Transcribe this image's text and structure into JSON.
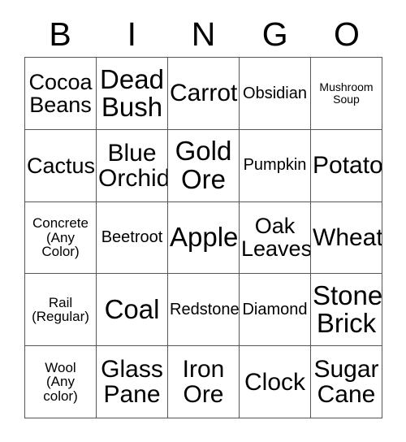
{
  "card": {
    "header_letters": [
      "B",
      "I",
      "N",
      "G",
      "O"
    ],
    "columns": 5,
    "rows": 5,
    "border_color": "#555555",
    "text_color": "#000000",
    "background_color": "#ffffff",
    "cells": [
      {
        "text": "Cocoa\nBeans",
        "size": "lg"
      },
      {
        "text": "Dead\nBush",
        "size": "xxl"
      },
      {
        "text": "Carrot",
        "size": "xl"
      },
      {
        "text": "Obsidian",
        "size": "sm"
      },
      {
        "text": "Mushroom\nSoup",
        "size": "xxs"
      },
      {
        "text": "Cactus",
        "size": "lg"
      },
      {
        "text": "Blue\nOrchid",
        "size": "xl"
      },
      {
        "text": "Gold\nOre",
        "size": "xxl"
      },
      {
        "text": "Pumpkin",
        "size": "sm"
      },
      {
        "text": "Potato",
        "size": "xl"
      },
      {
        "text": "Concrete\n(Any\nColor)",
        "size": "xs"
      },
      {
        "text": "Beetroot",
        "size": "sm"
      },
      {
        "text": "Apple",
        "size": "xxl"
      },
      {
        "text": "Oak\nLeaves",
        "size": "lg"
      },
      {
        "text": "Wheat",
        "size": "xl"
      },
      {
        "text": "Rail\n(Regular)",
        "size": "xs"
      },
      {
        "text": "Coal",
        "size": "xxl"
      },
      {
        "text": "Redstone",
        "size": "sm"
      },
      {
        "text": "Diamond",
        "size": "sm"
      },
      {
        "text": "Stone\nBrick",
        "size": "xxl"
      },
      {
        "text": "Wool\n(Any\ncolor)",
        "size": "xs"
      },
      {
        "text": "Glass\nPane",
        "size": "xl"
      },
      {
        "text": "Iron\nOre",
        "size": "xl"
      },
      {
        "text": "Clock",
        "size": "xl"
      },
      {
        "text": "Sugar\nCane",
        "size": "xl"
      }
    ]
  }
}
